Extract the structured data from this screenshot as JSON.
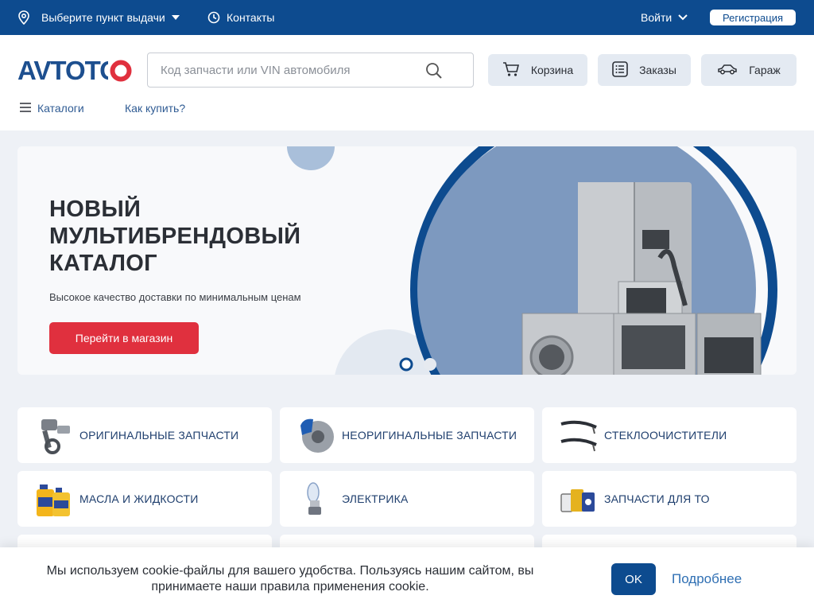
{
  "topbar": {
    "pickup_label": "Выберите пункт выдачи",
    "contacts_label": "Контакты",
    "login_label": "Войти",
    "register_label": "Регистрация"
  },
  "header": {
    "logo_text": "AVTOTO",
    "search_placeholder": "Код запчасти или VIN автомобиля",
    "cart_label": "Корзина",
    "orders_label": "Заказы",
    "garage_label": "Гараж"
  },
  "nav": {
    "catalogs_label": "Каталоги",
    "how_to_buy_label": "Как купить?"
  },
  "banner": {
    "title_line1": "НОВЫЙ",
    "title_line2": "МУЛЬТИБРЕНДОВЫЙ",
    "title_line3": "КАТАЛОГ",
    "subtitle": "Высокое качество доставки по минимальным ценам",
    "cta_label": "Перейти в магазин",
    "slides_total": 2,
    "active_slide": 1
  },
  "categories": [
    {
      "label": "ОРИГИНАЛЬНЫЕ ЗАПЧАСТИ",
      "icon": "piston-icon"
    },
    {
      "label": "НЕОРИГИНАЛЬНЫЕ ЗАПЧАСТИ",
      "icon": "brake-disc-icon"
    },
    {
      "label": "СТЕКЛООЧИСТИТЕЛИ",
      "icon": "wiper-icon"
    },
    {
      "label": "МАСЛА И ЖИДКОСТИ",
      "icon": "oil-can-icon"
    },
    {
      "label": "ЭЛЕКТРИКА",
      "icon": "bulb-icon"
    },
    {
      "label": "ЗАПЧАСТИ ДЛЯ ТО",
      "icon": "filters-icon"
    }
  ],
  "cookie": {
    "text": "Мы используем cookie-файлы для вашего удобства. Пользуясь нашим сайтом, вы принимаете наши правила применения cookie.",
    "ok_label": "OK",
    "more_label": "Подробнее"
  },
  "colors": {
    "brand_blue": "#0d4b8f",
    "accent_red": "#e0303e",
    "button_bg": "#e4eaf2"
  }
}
